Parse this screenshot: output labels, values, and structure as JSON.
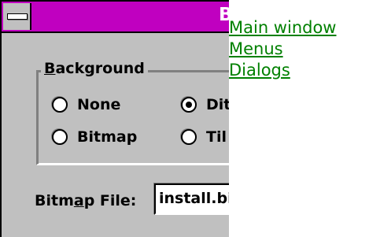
{
  "dialog": {
    "title": "B",
    "system_menu": "system-menu",
    "group": {
      "legend_prefix": "",
      "legend_mnemonic": "B",
      "legend_rest": "ackground",
      "options": [
        {
          "label": "None",
          "checked": false
        },
        {
          "label": "Dit",
          "checked": true
        },
        {
          "label": "Bitmap",
          "checked": false
        },
        {
          "label": "Til",
          "checked": false
        }
      ]
    },
    "bitmap_field": {
      "label_prefix": "Bitm",
      "label_mnemonic": "a",
      "label_rest": "p File:",
      "value": "install.bi"
    }
  },
  "links": [
    "Main window",
    "Menus",
    "Dialogs"
  ],
  "colors": {
    "face": "#c0c0c0",
    "titlebar": "#c000c0",
    "link": "#008000"
  }
}
